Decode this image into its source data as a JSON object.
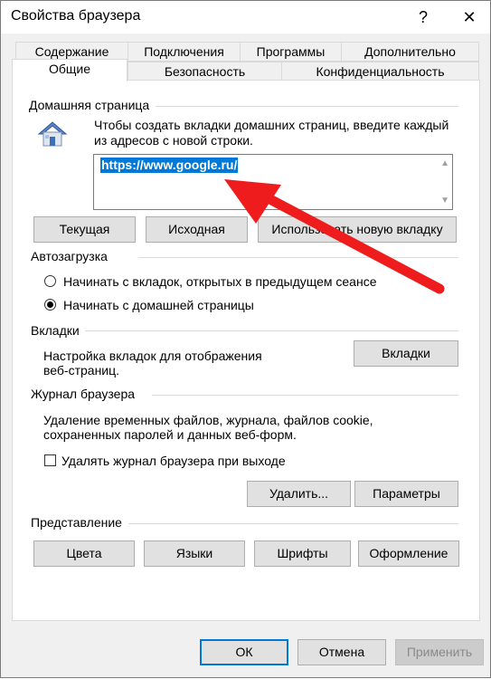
{
  "window": {
    "title": "Свойства браузера",
    "help_glyph": "?",
    "close_glyph": "✕"
  },
  "tabs": {
    "row1": [
      "Содержание",
      "Подключения",
      "Программы",
      "Дополнительно"
    ],
    "row2": [
      "Общие",
      "Безопасность",
      "Конфиденциальность"
    ],
    "active": "Общие"
  },
  "home": {
    "group_label": "Домашняя страница",
    "description_line1": "Чтобы создать вкладки домашних страниц, введите каждый",
    "description_line2": "из адресов с новой строки.",
    "url": "https://www.google.ru/",
    "buttons": {
      "current": "Текущая",
      "default": "Исходная",
      "new_tab": "Использовать новую вкладку"
    }
  },
  "startup": {
    "group_label": "Автозагрузка",
    "option_tabs": "Начинать с вкладок, открытых в предыдущем сеансе",
    "option_home": "Начинать с домашней страницы",
    "selected": "home"
  },
  "tabs_section": {
    "group_label": "Вкладки",
    "description_line1": "Настройка вкладок для отображения",
    "description_line2": "веб-страниц.",
    "button": "Вкладки"
  },
  "history": {
    "group_label": "Журнал браузера",
    "description_line1": "Удаление временных файлов, журнала, файлов cookie,",
    "description_line2": "сохраненных паролей и данных веб-форм.",
    "delete_on_exit": "Удалять журнал браузера при выходе",
    "delete_on_exit_checked": false,
    "delete_button": "Удалить...",
    "settings_button": "Параметры"
  },
  "appearance": {
    "group_label": "Представление",
    "buttons": [
      "Цвета",
      "Языки",
      "Шрифты",
      "Оформление"
    ]
  },
  "footer": {
    "ok": "ОК",
    "cancel": "Отмена",
    "apply": "Применить"
  },
  "colors": {
    "selection": "#0078d7",
    "annotation_arrow": "#ee1c1c"
  }
}
